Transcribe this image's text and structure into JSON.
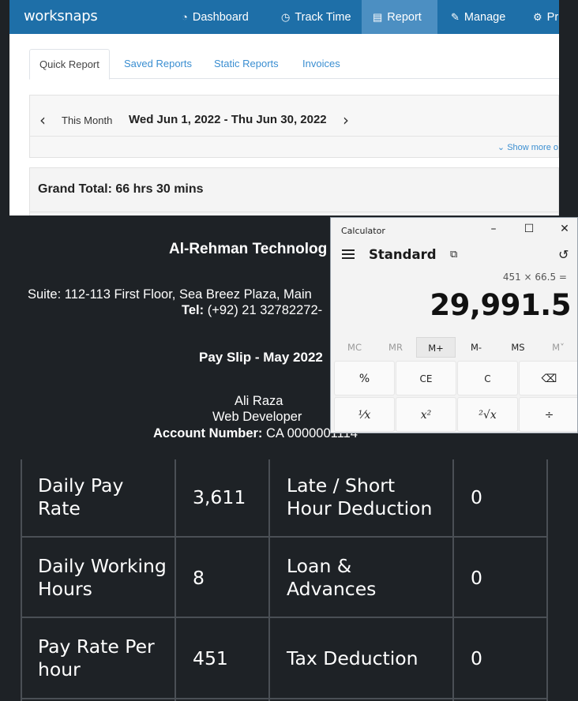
{
  "worksnaps": {
    "logo_prefix": "work",
    "logo_suffix": "snaps",
    "nav": [
      {
        "label": "Dashboard"
      },
      {
        "label": "Track Time"
      },
      {
        "label": "Report"
      },
      {
        "label": "Manage"
      },
      {
        "label": "Pr"
      }
    ],
    "tabs": [
      {
        "label": "Quick Report"
      },
      {
        "label": "Saved Reports"
      },
      {
        "label": "Static Reports"
      },
      {
        "label": "Invoices"
      }
    ],
    "period_label": "This Month",
    "date_range": "Wed Jun 1, 2022 - Thu Jun 30, 2022",
    "show_more": "Show more o",
    "grand_total": "Grand Total: 66 hrs 30 mins"
  },
  "payslip": {
    "company": "Al-Rehman Technolog",
    "address": "Suite: 112-113 First Floor, Sea Breez Plaza, Main",
    "tel_label": "Tel:",
    "tel_value": " (+92) 21 32782272-",
    "title": "Pay Slip - May 2022",
    "employee_name": "Ali Raza",
    "employee_title": "Web Developer",
    "account_label": "Account Number:",
    "account_value": " CA 0000001114",
    "rows": [
      {
        "label1": "Daily Pay Rate",
        "value1": "3,611",
        "label2": "Late / Short Hour Deduction",
        "value2": "0"
      },
      {
        "label1": "Daily Working Hours",
        "value1": "8",
        "label2": "Loan & Advances",
        "value2": "0"
      },
      {
        "label1": "Pay Rate Per hour",
        "value1": "451",
        "label2": "Tax Deduction",
        "value2": "0"
      }
    ]
  },
  "calculator": {
    "title": "Calculator",
    "mode": "Standard",
    "expression": "451 × 66.5 =",
    "result": "29,991.5",
    "memory_buttons": [
      "MC",
      "MR",
      "M+",
      "M-",
      "MS",
      "M˅"
    ],
    "keys": [
      "%",
      "CE",
      "C",
      "⌫",
      "¹⁄x",
      "x²",
      "²√x",
      "÷"
    ]
  }
}
